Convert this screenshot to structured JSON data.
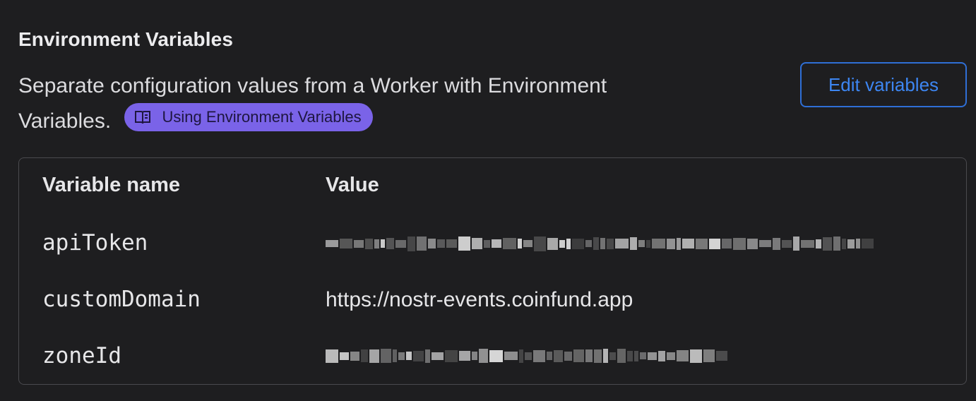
{
  "section": {
    "title": "Environment Variables",
    "description": "Separate configuration values from a Worker with Environment Variables.",
    "doc_link_label": "Using Environment Variables",
    "doc_link_icon": "book-icon",
    "edit_button_label": "Edit variables"
  },
  "table": {
    "headers": [
      "Variable name",
      "Value"
    ],
    "rows": [
      {
        "name": "apiToken",
        "value": "",
        "redacted": true
      },
      {
        "name": "customDomain",
        "value": "https://nostr-events.coinfund.app",
        "redacted": false
      },
      {
        "name": "zoneId",
        "value": "",
        "redacted": true
      }
    ]
  },
  "colors": {
    "background": "#1e1e20",
    "accent_button": "#3d86f2",
    "pill_background": "#7a63e8",
    "pill_text": "#1e1640",
    "border": "#4a4a4e"
  }
}
